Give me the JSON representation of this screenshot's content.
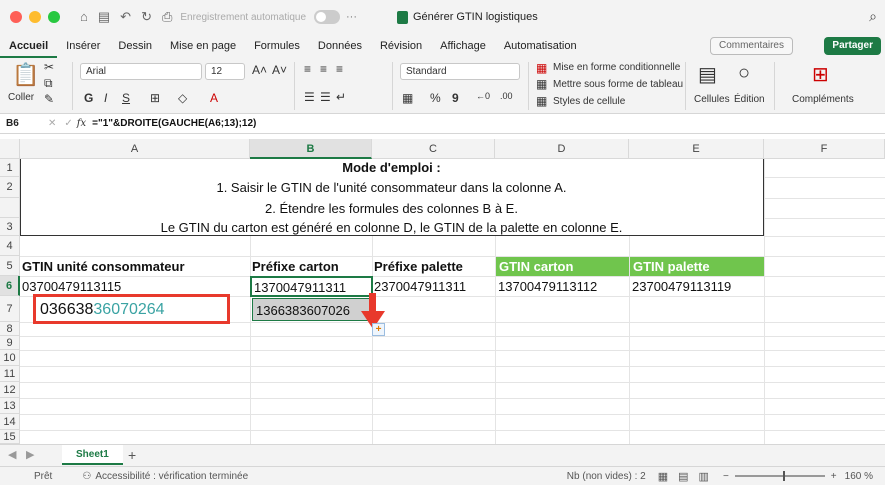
{
  "titlebar": {
    "autosave_label": "Enregistrement automatique",
    "doc_title": "Générer GTIN logistiques",
    "more": "···"
  },
  "tabs": [
    "Accueil",
    "Insérer",
    "Dessin",
    "Mise en page",
    "Formules",
    "Données",
    "Révision",
    "Affichage",
    "Automatisation"
  ],
  "actions": {
    "comments": "Commentaires",
    "share": "Partager"
  },
  "ribbon": {
    "paste": "Coller",
    "font": "Arial",
    "font_size": "12",
    "bold": "G",
    "italic": "I",
    "underline": "S",
    "number_format": "Standard",
    "percent": "%",
    "comma": "9",
    "cond_format": "Mise en forme conditionnelle",
    "table_format": "Mettre sous forme de tableau",
    "cell_styles": "Styles de cellule",
    "cells": "Cellules",
    "edit": "Édition",
    "addins": "Compléments"
  },
  "formula_bar": {
    "name_box": "B6",
    "fx": "fx",
    "formula": "=\"1\"&DROITE(GAUCHE(A6;13);12)"
  },
  "columns": [
    "A",
    "B",
    "C",
    "D",
    "E",
    "F"
  ],
  "rows": [
    "1",
    "2",
    "3",
    "4",
    "5",
    "6",
    "7",
    "8",
    "9",
    "10",
    "11",
    "12",
    "13",
    "14",
    "15"
  ],
  "instructions": {
    "title": "Mode d'emploi :",
    "line1": "1. Saisir le GTIN de l'unité consommateur dans la colonne A.",
    "line2": "2. Étendre les formules des colonnes B à E.",
    "line3": "Le GTIN du carton est généré en colonne D, le GTIN de la palette en colonne E."
  },
  "headers": {
    "a": "GTIN unité consommateur",
    "b": "Préfixe carton",
    "c": "Préfixe palette",
    "d": "GTIN carton",
    "e": "GTIN palette"
  },
  "row6": {
    "a": "03700479113115",
    "b": "1370047911311",
    "c": "2370047911311",
    "d": "13700479113112",
    "e": "23700479113119"
  },
  "row7": {
    "a_part1": "036638",
    "a_part2": "36070264",
    "b": "1366383607026"
  },
  "sheet": {
    "name": "Sheet1",
    "add": "+"
  },
  "status": {
    "ready": "Prêt",
    "accessibility": "Accessibilité : vérification terminée",
    "count": "Nb (non vides) : 2",
    "zoom": "160 %"
  },
  "colors": {
    "accent": "#1d7a45",
    "header_green": "#70c54d",
    "highlight_red": "#e8392c",
    "teal_digits": "#3aa3a3"
  }
}
